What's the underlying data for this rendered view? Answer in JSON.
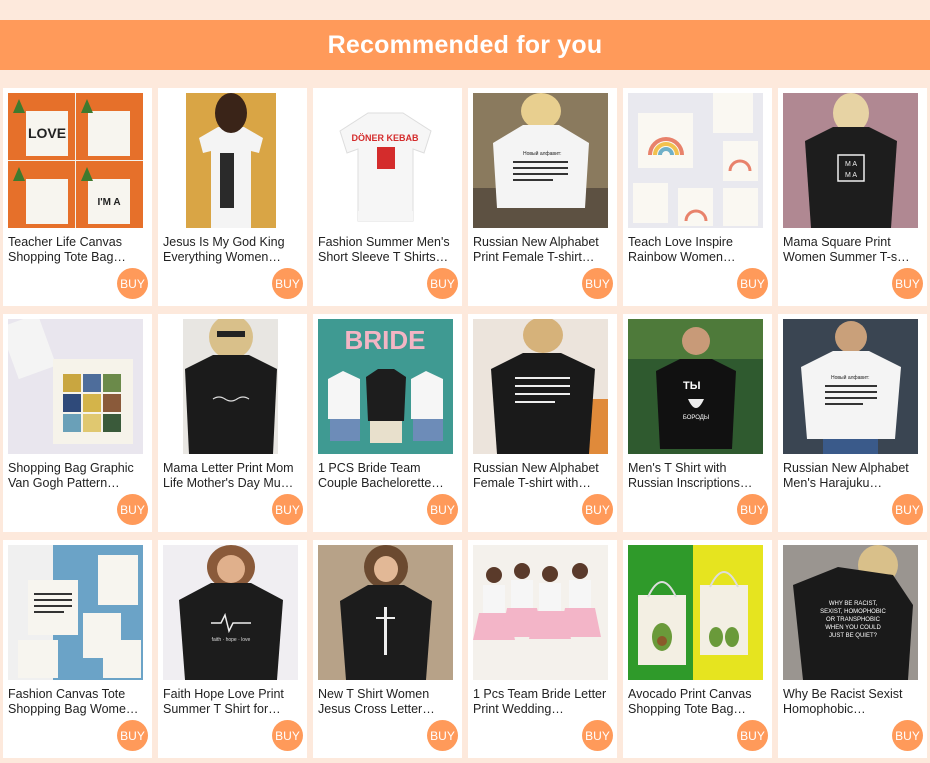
{
  "header": {
    "title": "Recommended for you"
  },
  "colors": {
    "accent": "#ff9a5a",
    "background": "#fde9dc"
  },
  "products": [
    {
      "title": "Teacher Life Canvas Shopping Tote Bag…",
      "buy": "BUY",
      "icon": "tote-bag-image"
    },
    {
      "title": "Jesus Is My God King Everything Women…",
      "buy": "BUY",
      "icon": "tshirt-image"
    },
    {
      "title": "Fashion Summer Men's Short Sleeve T Shirts…",
      "buy": "BUY",
      "icon": "tshirt-image",
      "print": "DÖNER KEBAB"
    },
    {
      "title": "Russian New Alphabet Print Female T-shirt…",
      "buy": "BUY",
      "icon": "tshirt-image"
    },
    {
      "title": "Teach Love Inspire Rainbow Women…",
      "buy": "BUY",
      "icon": "tote-bag-image"
    },
    {
      "title": "Mama Square Print Women Summer T-s…",
      "buy": "BUY",
      "icon": "tshirt-image",
      "print": "MAMA"
    },
    {
      "title": "Shopping Bag Graphic Van Gogh Pattern…",
      "buy": "BUY",
      "icon": "tote-bag-image"
    },
    {
      "title": "Mama Letter Print Mom Life Mother's Day Mu…",
      "buy": "BUY",
      "icon": "tshirt-image"
    },
    {
      "title": "1 PCS Bride Team Couple Bachelorette…",
      "buy": "BUY",
      "icon": "tshirt-image",
      "print": "BRIDE"
    },
    {
      "title": "Russian New Alphabet Female T-shirt with…",
      "buy": "BUY",
      "icon": "tshirt-image"
    },
    {
      "title": "Men's T Shirt with Russian Inscriptions…",
      "buy": "BUY",
      "icon": "tshirt-image"
    },
    {
      "title": "Russian New Alphabet Men's Harajuku…",
      "buy": "BUY",
      "icon": "tshirt-image"
    },
    {
      "title": "Fashion Canvas Tote Shopping Bag Wome…",
      "buy": "BUY",
      "icon": "tote-bag-image"
    },
    {
      "title": "Faith Hope Love Print Summer T Shirt for…",
      "buy": "BUY",
      "icon": "tshirt-image"
    },
    {
      "title": "New T Shirt Women Jesus Cross Letter…",
      "buy": "BUY",
      "icon": "tshirt-image"
    },
    {
      "title": "1 Pcs Team Bride Letter Print Wedding…",
      "buy": "BUY",
      "icon": "tshirt-image"
    },
    {
      "title": "Avocado Print Canvas Shopping Tote Bag…",
      "buy": "BUY",
      "icon": "tote-bag-image"
    },
    {
      "title": "Why Be Racist Sexist Homophobic…",
      "buy": "BUY",
      "icon": "tshirt-image"
    }
  ]
}
